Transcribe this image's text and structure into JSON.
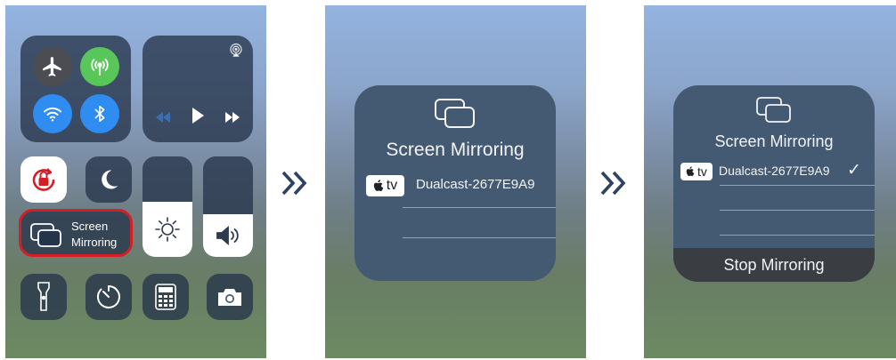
{
  "control_center": {
    "connectivity": {
      "airplane": "airplane-icon",
      "cellular": "cellular-antenna-icon",
      "wifi": "wifi-icon",
      "bluetooth": "bluetooth-icon"
    },
    "media": {
      "airplay": "airplay-icon"
    },
    "screen_mirroring": {
      "label_line1": "Screen",
      "label_line2": "Mirroring"
    }
  },
  "mirroring_menu": {
    "title": "Screen Mirroring",
    "tv_badge": "tv",
    "device_name": "Dualcast-2677E9A9"
  },
  "mirroring_connected": {
    "title": "Screen Mirroring",
    "tv_badge": "tv",
    "device_name": "Dualcast-2677E9A9",
    "checkmark": "✓",
    "stop_label": "Stop Mirroring"
  },
  "colors": {
    "highlight": "#d41f26",
    "wifi_blue": "#2f8cf0",
    "cellular_green": "#59c65a",
    "menu_bg": "#445a72",
    "stop_bar": "#3a3d42"
  }
}
